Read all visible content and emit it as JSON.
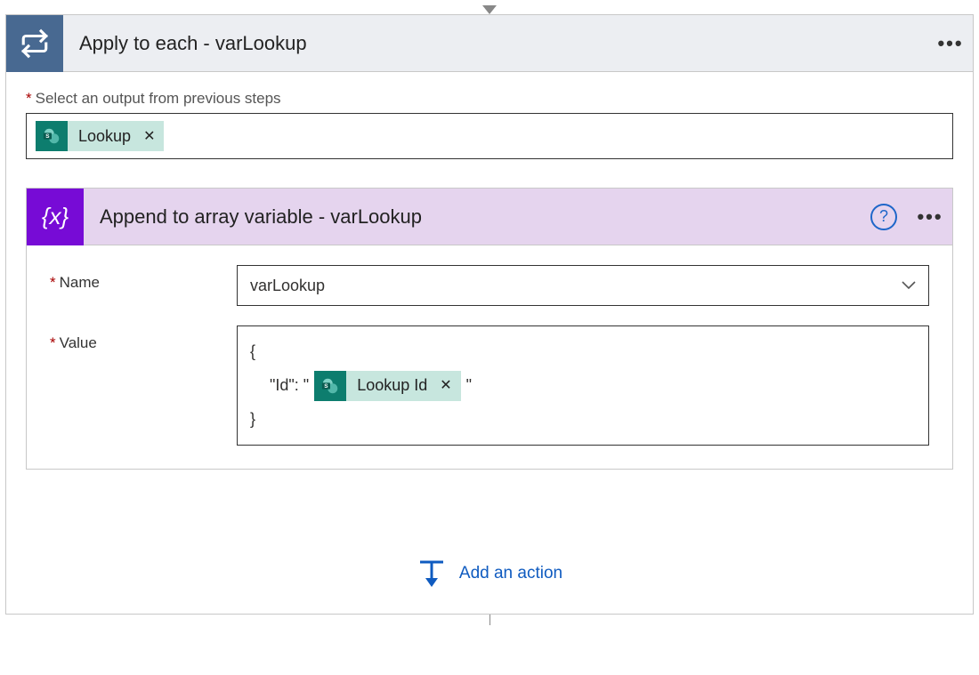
{
  "connector_down_visible": true,
  "outer": {
    "title": "Apply to each - varLookup",
    "select_label": "Select an output from previous steps",
    "token": {
      "label": "Lookup"
    }
  },
  "inner": {
    "title": "Append to array variable - varLookup",
    "name_label": "Name",
    "name_value": "varLookup",
    "value_label": "Value",
    "value_text": {
      "open": "{",
      "id_prefix": "\"Id\": \"",
      "token_label": "Lookup Id",
      "id_suffix": "\"",
      "close": "}"
    }
  },
  "add_action_label": "Add an action"
}
